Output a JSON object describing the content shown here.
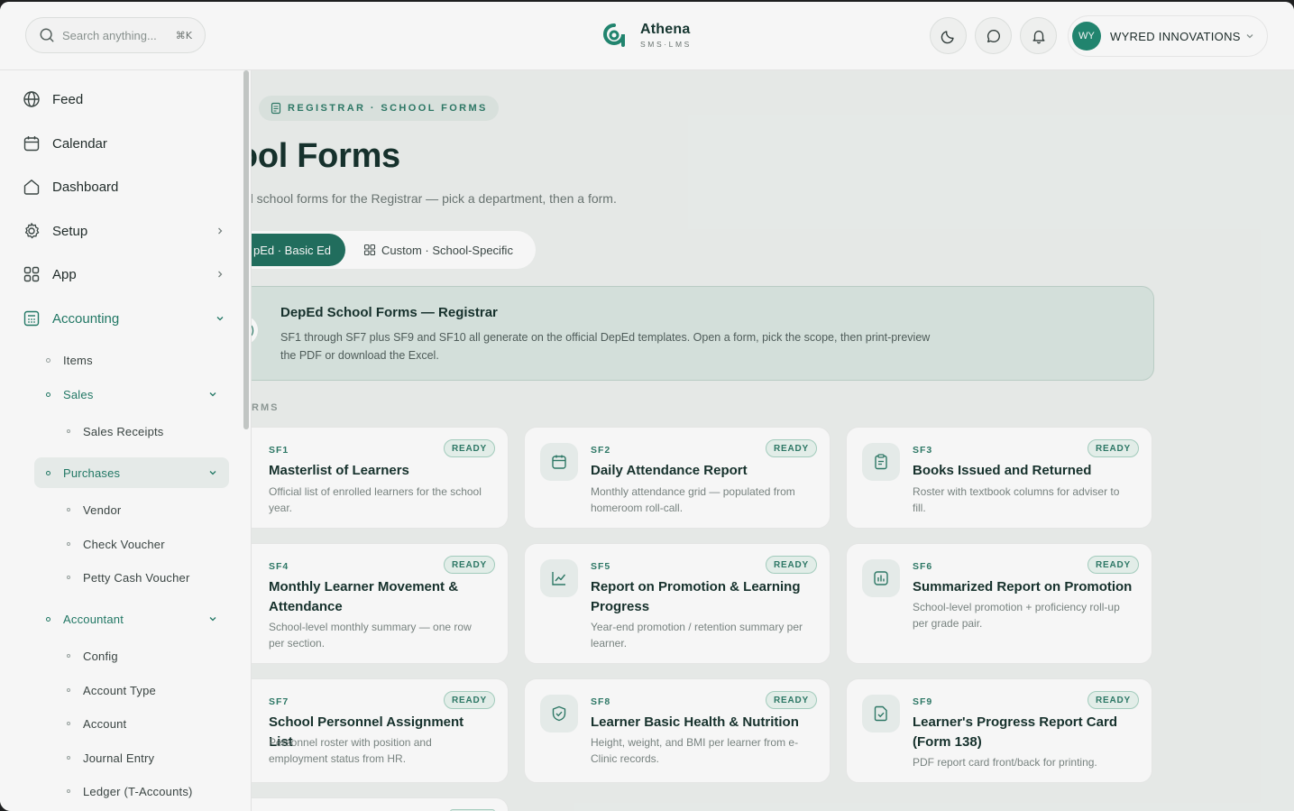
{
  "header": {
    "search_placeholder": "Search anything...",
    "search_shortcut": "⌘K",
    "brand_name": "Athena",
    "brand_tagline": "SMS·LMS",
    "user_initials": "WY",
    "user_name": "WYRED INNOVATIONS"
  },
  "sidebar": {
    "items": [
      {
        "label": "Feed",
        "icon": "globe-icon"
      },
      {
        "label": "Calendar",
        "icon": "calendar-icon"
      },
      {
        "label": "Dashboard",
        "icon": "home-icon"
      },
      {
        "label": "Setup",
        "icon": "gear-icon"
      },
      {
        "label": "App",
        "icon": "grid-icon"
      },
      {
        "label": "Accounting",
        "icon": "ledger-icon"
      }
    ],
    "accounting_sub": {
      "items": "Items",
      "sales": "Sales",
      "sales_receipts": "Sales Receipts",
      "purchases": "Purchases",
      "vendor": "Vendor",
      "check_voucher": "Check Voucher",
      "petty_cash_voucher": "Petty Cash Voucher",
      "accountant": "Accountant",
      "config": "Config",
      "account_type": "Account Type",
      "account": "Account",
      "journal_entry": "Journal Entry",
      "ledger": "Ledger (T-Accounts)"
    }
  },
  "main": {
    "breadcrumb": "REGISTRAR · SCHOOL FORMS",
    "title": "hool Forms",
    "subtitle": "d school forms for the Registrar — pick a department, then a form.",
    "tabs": {
      "active": "pEd · Basic Ed",
      "custom": "Custom · School-Specific"
    },
    "notice": {
      "icon_glyph": ")",
      "title": "DepEd School Forms — Registrar",
      "body": "SF1 through SF7 plus SF9 and SF10 all generate on the official DepEd templates. Open a form, pick the scope, then print-preview the PDF or download the Excel."
    },
    "section_label": "RMS",
    "status_ready": "READY",
    "cards": [
      {
        "code": "SF1",
        "title": "Masterlist of Learners",
        "desc": "Official list of enrolled learners for the school year.",
        "icon": "list-icon"
      },
      {
        "code": "SF2",
        "title": "Daily Attendance Report",
        "desc": "Monthly attendance grid — populated from homeroom roll-call.",
        "icon": "calendar-icon"
      },
      {
        "code": "SF3",
        "title": "Books Issued and Returned",
        "desc": "Roster with textbook columns for adviser to fill.",
        "icon": "clipboard-icon"
      },
      {
        "code": "SF4",
        "title": "Monthly Learner Movement & Attendance",
        "desc": "School-level monthly summary — one row per section.",
        "icon": "movement-icon"
      },
      {
        "code": "SF5",
        "title": "Report on Promotion & Learning Progress",
        "desc": "Year-end promotion / retention summary per learner.",
        "icon": "line-chart-icon"
      },
      {
        "code": "SF6",
        "title": "Summarized Report on Promotion",
        "desc": "School-level promotion + proficiency roll-up per grade pair.",
        "icon": "bar-chart-icon"
      },
      {
        "code": "SF7",
        "title": "School Personnel Assignment List",
        "desc": "Personnel roster with position and employment status from HR.",
        "icon": "people-icon"
      },
      {
        "code": "SF8",
        "title": "Learner Basic Health & Nutrition",
        "desc": "Height, weight, and BMI per learner from e-Clinic records.",
        "icon": "shield-check-icon"
      },
      {
        "code": "SF9",
        "title": "Learner's Progress Report Card (Form 138)",
        "desc": "PDF report card front/back for printing.",
        "icon": "file-check-icon"
      }
    ]
  },
  "colors": {
    "accent": "#1f6f5e",
    "accent_text": "#2c7a67",
    "badge_bg": "#eaf6f1",
    "page_bg": "#eef1ef"
  }
}
